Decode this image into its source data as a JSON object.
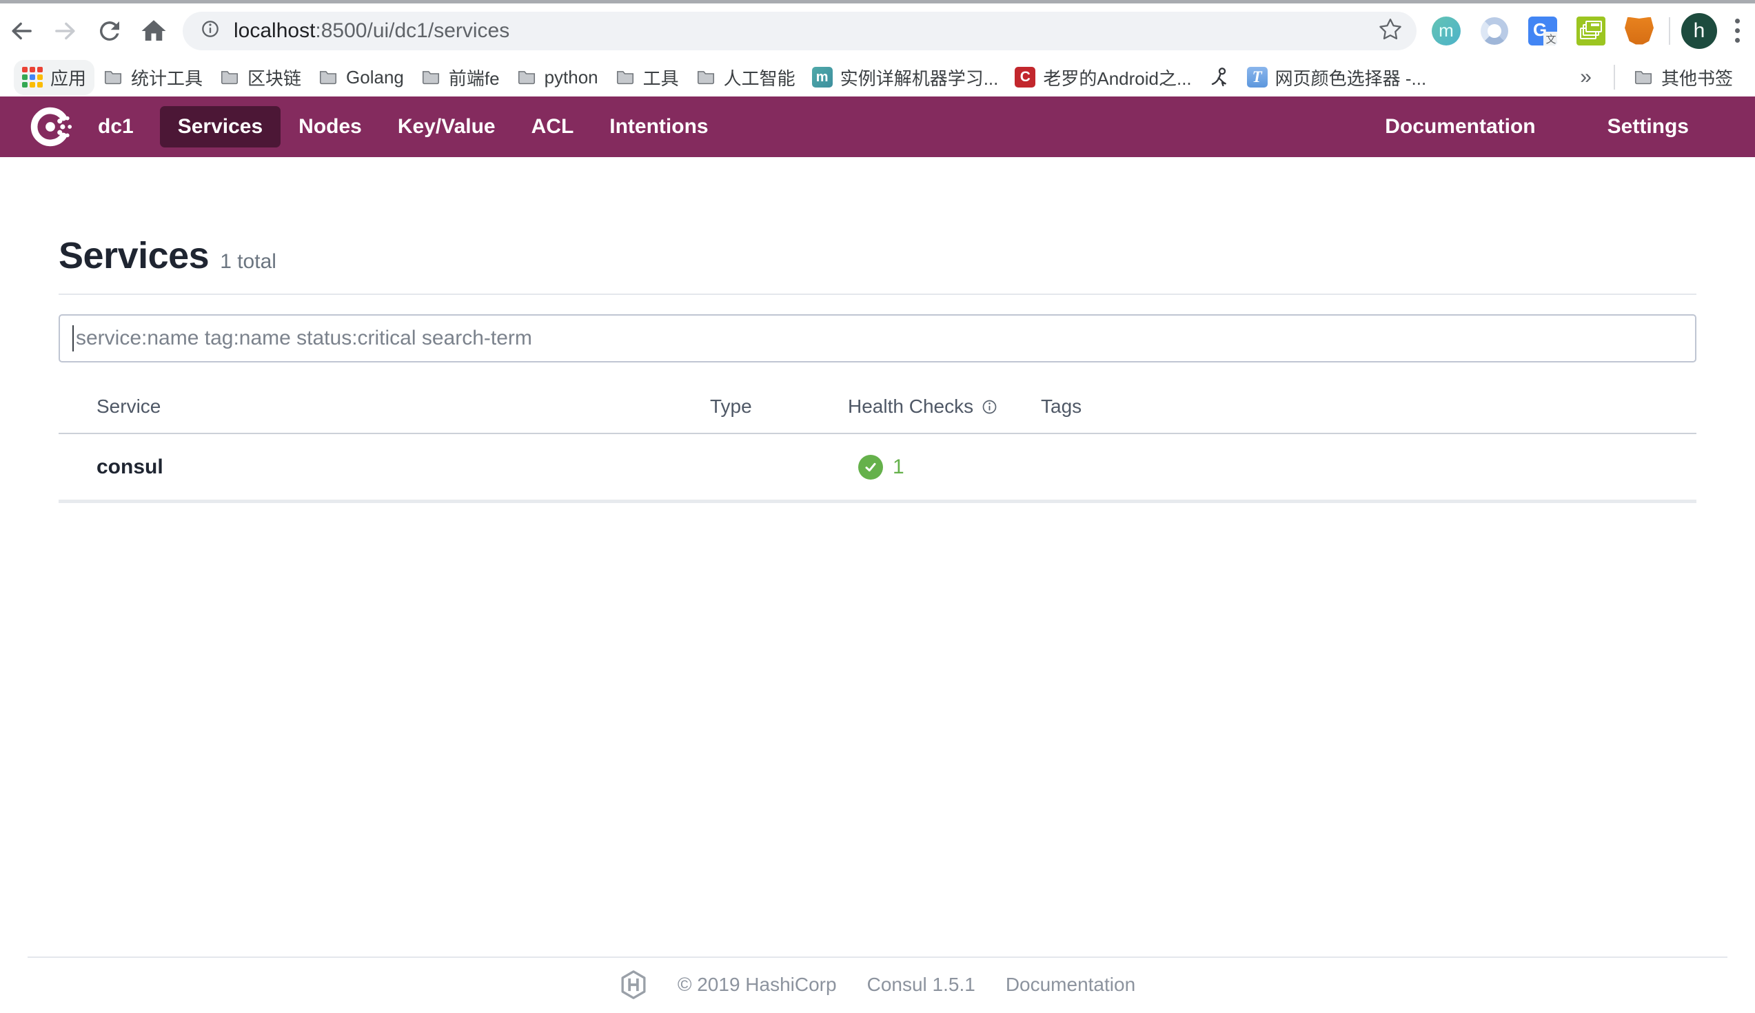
{
  "browser": {
    "url": {
      "host": "localhost",
      "path": ":8500/ui/dc1/services"
    },
    "profile_initial": "h",
    "ext_m_letter": "m",
    "translate_g": "G",
    "translate_wen": "文",
    "bookmarks": [
      {
        "label": "应用",
        "icon": "apps-grid-icon"
      },
      {
        "label": "统计工具",
        "icon": "folder-icon"
      },
      {
        "label": "区块链",
        "icon": "folder-icon"
      },
      {
        "label": "Golang",
        "icon": "folder-icon"
      },
      {
        "label": "前端fe",
        "icon": "folder-icon"
      },
      {
        "label": "python",
        "icon": "folder-icon"
      },
      {
        "label": "工具",
        "icon": "folder-icon"
      },
      {
        "label": "人工智能",
        "icon": "folder-icon"
      },
      {
        "label": "实例详解机器学习...",
        "icon": "m-favicon",
        "favicon_letter": "m"
      },
      {
        "label": "老罗的Android之...",
        "icon": "c-favicon",
        "favicon_letter": "C"
      },
      {
        "label": "",
        "icon": "person-glyph-favicon"
      },
      {
        "label": "网页颜色选择器 -...",
        "icon": "t-favicon",
        "favicon_letter": "T"
      }
    ],
    "overflow_chevron": "»",
    "other_bookmarks": "其他书签"
  },
  "navbar": {
    "datacenter": "dc1",
    "items": [
      {
        "label": "Services",
        "active": true
      },
      {
        "label": "Nodes",
        "active": false
      },
      {
        "label": "Key/Value",
        "active": false
      },
      {
        "label": "ACL",
        "active": false
      },
      {
        "label": "Intentions",
        "active": false
      }
    ],
    "right_items": [
      {
        "label": "Documentation"
      },
      {
        "label": "Settings"
      }
    ]
  },
  "page": {
    "title": "Services",
    "total_badge": "1 total",
    "search": {
      "placeholder": "service:name tag:name status:critical search-term"
    },
    "table": {
      "headers": [
        "Service",
        "Type",
        "Health Checks",
        "Tags"
      ],
      "rows": [
        {
          "service": "consul",
          "type": "",
          "health_passing": "1",
          "tags": ""
        }
      ]
    }
  },
  "footer": {
    "copyright": "© 2019 HashiCorp",
    "version": "Consul 1.5.1",
    "docs": "Documentation"
  },
  "colors": {
    "navbar": "#842B5E",
    "navbar_active": "#4C1736",
    "health_green": "#65B14B",
    "url_bar_bg": "#F0F2F5"
  }
}
